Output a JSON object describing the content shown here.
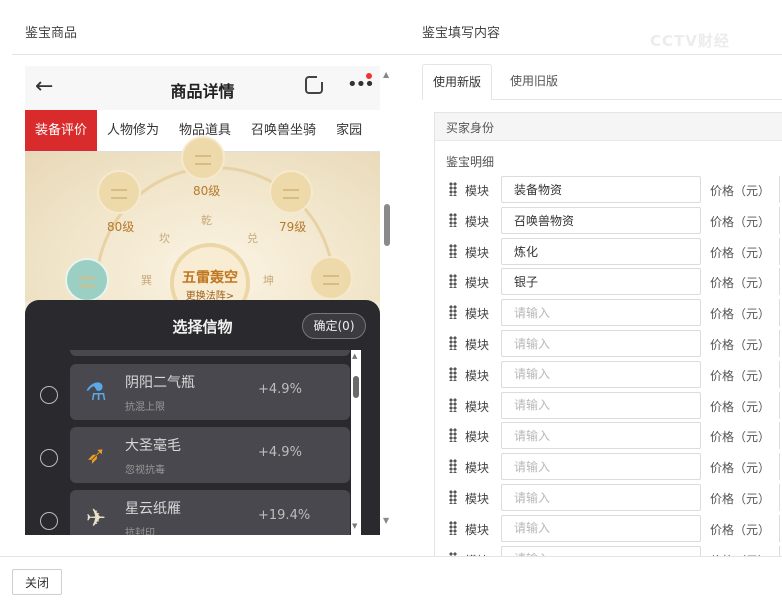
{
  "left_panel": {
    "title": "鉴宝商品"
  },
  "right_panel": {
    "title": "鉴宝填写内容"
  },
  "watermark": "CCTV财经",
  "phone": {
    "header_title": "商品详情",
    "tabs": [
      "装备评价",
      "人物修为",
      "物品道具",
      "召唤兽坐骑",
      "家园"
    ],
    "active_tab": 0,
    "game": {
      "levels": [
        "80级",
        "80级",
        "79级"
      ],
      "center_title": "五雷轰空",
      "center_sub": "更换法阵>",
      "glyphs": [
        "乾",
        "坎",
        "兑",
        "巽",
        "坤"
      ]
    },
    "sheet": {
      "title": "选择信物",
      "confirm_label": "确定(0)",
      "items": [
        {
          "name": "阴阳二气瓶",
          "desc": "抗混上限",
          "value": "+4.9%",
          "icon": "vase-icon",
          "icon_color": "#5aa8e8"
        },
        {
          "name": "大圣毫毛",
          "desc": "忽视抗毒",
          "value": "+4.9%",
          "icon": "feather-icon",
          "icon_color": "#f0a020"
        },
        {
          "name": "星云纸雁",
          "desc": "抗封印",
          "value": "+19.4%",
          "icon": "crane-icon",
          "icon_color": "#e8e0c8"
        }
      ]
    }
  },
  "form": {
    "tabs": [
      "使用新版",
      "使用旧版"
    ],
    "active_tab": 0,
    "buyer_label": "买家身份",
    "section_label": "鉴宝明细",
    "row_label": "模块",
    "price_label": "价格（元）",
    "placeholder": "请输入",
    "rows": [
      {
        "value": "装备物资"
      },
      {
        "value": "召唤兽物资"
      },
      {
        "value": "炼化"
      },
      {
        "value": "银子"
      },
      {
        "value": ""
      },
      {
        "value": ""
      },
      {
        "value": ""
      },
      {
        "value": ""
      },
      {
        "value": ""
      },
      {
        "value": ""
      },
      {
        "value": ""
      },
      {
        "value": ""
      },
      {
        "value": ""
      }
    ]
  },
  "footer": {
    "close_label": "关闭"
  }
}
